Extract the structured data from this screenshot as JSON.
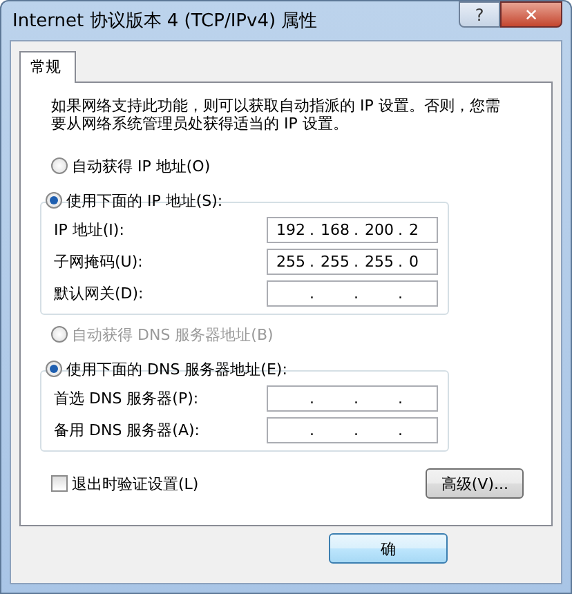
{
  "window": {
    "title": "Internet 协议版本 4 (TCP/IPv4) 属性",
    "help": "?",
    "close": "✕"
  },
  "tabs": [
    {
      "label": "常规",
      "selected": true
    }
  ],
  "intro": "如果网络支持此功能，则可以获取自动指派的 IP 设置。否则，您需要从网络系统管理员处获得适当的 IP 设置。",
  "ip": {
    "auto": {
      "label": "自动获得 IP 地址(O)",
      "selected": false,
      "disabled": false
    },
    "manual": {
      "label": "使用下面的 IP 地址(S):",
      "selected": true,
      "disabled": false
    },
    "fields": [
      {
        "label": "IP 地址(I):",
        "octets": [
          "192",
          "168",
          "200",
          "2"
        ],
        "dots": [
          ".",
          ".",
          "."
        ]
      },
      {
        "label": "子网掩码(U):",
        "octets": [
          "255",
          "255",
          "255",
          "0"
        ],
        "dots": [
          ".",
          ".",
          "."
        ]
      },
      {
        "label": "默认网关(D):",
        "dots": [
          ".",
          ".",
          "."
        ]
      }
    ]
  },
  "dns": {
    "auto": {
      "label": "自动获得 DNS 服务器地址(B)",
      "selected": false,
      "disabled": true
    },
    "manual": {
      "label": "使用下面的 DNS 服务器地址(E):",
      "selected": true,
      "disabled": false
    },
    "fields": [
      {
        "label": "首选 DNS 服务器(P):",
        "dots": [
          ".",
          ".",
          "."
        ]
      },
      {
        "label": "备用 DNS 服务器(A):",
        "dots": [
          ".",
          ".",
          "."
        ]
      }
    ]
  },
  "validate": {
    "label": "退出时验证设置(L)",
    "checked": false
  },
  "advanced_button": "高级(V)...",
  "ok_button": "确"
}
